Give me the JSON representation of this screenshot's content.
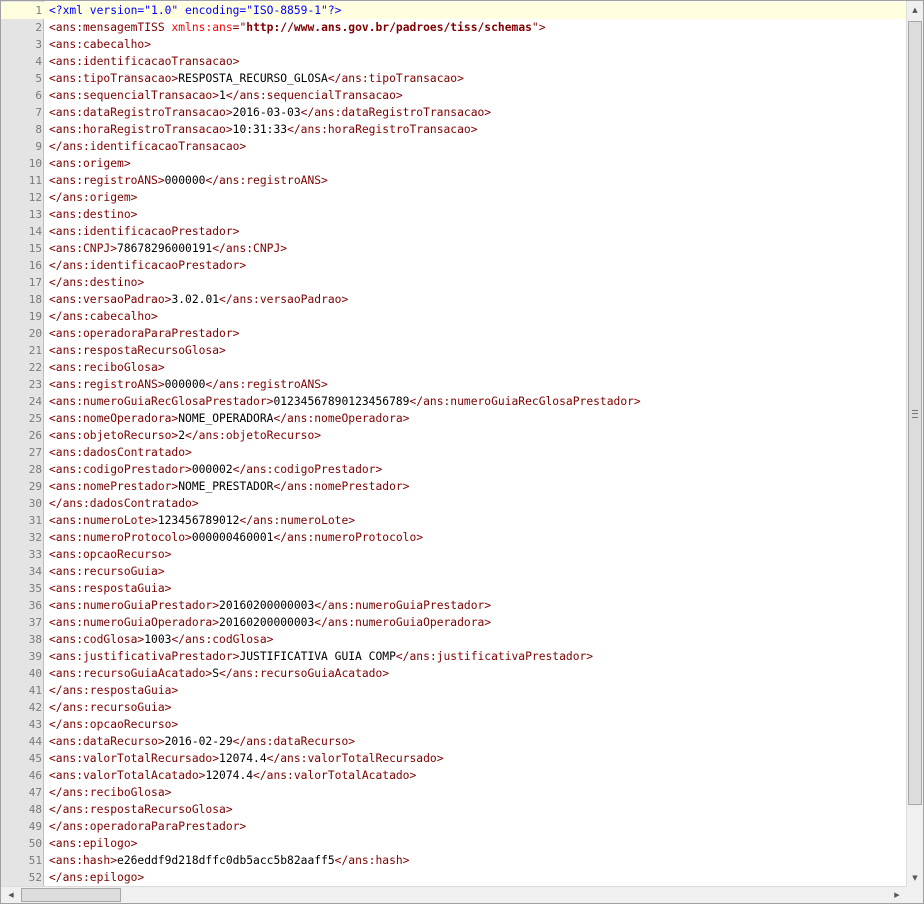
{
  "editor": {
    "current_line": 1,
    "lines": [
      [
        [
          "pi",
          "<?xml version=\"1.0\" encoding=\"ISO-8859-1\"?>"
        ]
      ],
      [
        [
          "tag",
          "<ans:mensagemTISS "
        ],
        [
          "attr",
          "xmlns:ans"
        ],
        [
          "tag",
          "=\""
        ],
        [
          "val",
          "http://www.ans.gov.br/padroes/tiss/schemas"
        ],
        [
          "tag",
          "\">"
        ]
      ],
      [
        [
          "tag",
          "<ans:cabecalho>"
        ]
      ],
      [
        [
          "tag",
          "<ans:identificacaoTransacao>"
        ]
      ],
      [
        [
          "tag",
          "<ans:tipoTransacao>"
        ],
        [
          "txt",
          "RESPOSTA_RECURSO_GLOSA"
        ],
        [
          "tag",
          "</ans:tipoTransacao>"
        ]
      ],
      [
        [
          "tag",
          "<ans:sequencialTransacao>"
        ],
        [
          "txt",
          "1"
        ],
        [
          "tag",
          "</ans:sequencialTransacao>"
        ]
      ],
      [
        [
          "tag",
          "<ans:dataRegistroTransacao>"
        ],
        [
          "txt",
          "2016-03-03"
        ],
        [
          "tag",
          "</ans:dataRegistroTransacao>"
        ]
      ],
      [
        [
          "tag",
          "<ans:horaRegistroTransacao>"
        ],
        [
          "txt",
          "10:31:33"
        ],
        [
          "tag",
          "</ans:horaRegistroTransacao>"
        ]
      ],
      [
        [
          "tag",
          "</ans:identificacaoTransacao>"
        ]
      ],
      [
        [
          "tag",
          "<ans:origem>"
        ]
      ],
      [
        [
          "tag",
          "<ans:registroANS>"
        ],
        [
          "txt",
          "000000"
        ],
        [
          "tag",
          "</ans:registroANS>"
        ]
      ],
      [
        [
          "tag",
          "</ans:origem>"
        ]
      ],
      [
        [
          "tag",
          "<ans:destino>"
        ]
      ],
      [
        [
          "tag",
          "<ans:identificacaoPrestador>"
        ]
      ],
      [
        [
          "tag",
          "<ans:CNPJ>"
        ],
        [
          "txt",
          "78678296000191"
        ],
        [
          "tag",
          "</ans:CNPJ>"
        ]
      ],
      [
        [
          "tag",
          "</ans:identificacaoPrestador>"
        ]
      ],
      [
        [
          "tag",
          "</ans:destino>"
        ]
      ],
      [
        [
          "tag",
          "<ans:versaoPadrao>"
        ],
        [
          "txt",
          "3.02.01"
        ],
        [
          "tag",
          "</ans:versaoPadrao>"
        ]
      ],
      [
        [
          "tag",
          "</ans:cabecalho>"
        ]
      ],
      [
        [
          "tag",
          "<ans:operadoraParaPrestador>"
        ]
      ],
      [
        [
          "tag",
          "<ans:respostaRecursoGlosa>"
        ]
      ],
      [
        [
          "tag",
          "<ans:reciboGlosa>"
        ]
      ],
      [
        [
          "tag",
          "<ans:registroANS>"
        ],
        [
          "txt",
          "000000"
        ],
        [
          "tag",
          "</ans:registroANS>"
        ]
      ],
      [
        [
          "tag",
          "<ans:numeroGuiaRecGlosaPrestador>"
        ],
        [
          "txt",
          "01234567890123456789"
        ],
        [
          "tag",
          "</ans:numeroGuiaRecGlosaPrestador>"
        ]
      ],
      [
        [
          "tag",
          "<ans:nomeOperadora>"
        ],
        [
          "txt",
          "NOME_OPERADORA"
        ],
        [
          "tag",
          "</ans:nomeOperadora>"
        ]
      ],
      [
        [
          "tag",
          "<ans:objetoRecurso>"
        ],
        [
          "txt",
          "2"
        ],
        [
          "tag",
          "</ans:objetoRecurso>"
        ]
      ],
      [
        [
          "tag",
          "<ans:dadosContratado>"
        ]
      ],
      [
        [
          "tag",
          "<ans:codigoPrestador>"
        ],
        [
          "txt",
          "000002"
        ],
        [
          "tag",
          "</ans:codigoPrestador>"
        ]
      ],
      [
        [
          "tag",
          "<ans:nomePrestador>"
        ],
        [
          "txt",
          "NOME_PRESTADOR"
        ],
        [
          "tag",
          "</ans:nomePrestador>"
        ]
      ],
      [
        [
          "tag",
          "</ans:dadosContratado>"
        ]
      ],
      [
        [
          "tag",
          "<ans:numeroLote>"
        ],
        [
          "txt",
          "123456789012"
        ],
        [
          "tag",
          "</ans:numeroLote>"
        ]
      ],
      [
        [
          "tag",
          "<ans:numeroProtocolo>"
        ],
        [
          "txt",
          "000000460001"
        ],
        [
          "tag",
          "</ans:numeroProtocolo>"
        ]
      ],
      [
        [
          "tag",
          "<ans:opcaoRecurso>"
        ]
      ],
      [
        [
          "tag",
          "<ans:recursoGuia>"
        ]
      ],
      [
        [
          "tag",
          "<ans:respostaGuia>"
        ]
      ],
      [
        [
          "tag",
          "<ans:numeroGuiaPrestador>"
        ],
        [
          "txt",
          "20160200000003"
        ],
        [
          "tag",
          "</ans:numeroGuiaPrestador>"
        ]
      ],
      [
        [
          "tag",
          "<ans:numeroGuiaOperadora>"
        ],
        [
          "txt",
          "20160200000003"
        ],
        [
          "tag",
          "</ans:numeroGuiaOperadora>"
        ]
      ],
      [
        [
          "tag",
          "<ans:codGlosa>"
        ],
        [
          "txt",
          "1003"
        ],
        [
          "tag",
          "</ans:codGlosa>"
        ]
      ],
      [
        [
          "tag",
          "<ans:justificativaPrestador>"
        ],
        [
          "txt",
          "JUSTIFICATIVA GUIA COMP"
        ],
        [
          "tag",
          "</ans:justificativaPrestador>"
        ]
      ],
      [
        [
          "tag",
          "<ans:recursoGuiaAcatado>"
        ],
        [
          "txt",
          "S"
        ],
        [
          "tag",
          "</ans:recursoGuiaAcatado>"
        ]
      ],
      [
        [
          "tag",
          "</ans:respostaGuia>"
        ]
      ],
      [
        [
          "tag",
          "</ans:recursoGuia>"
        ]
      ],
      [
        [
          "tag",
          "</ans:opcaoRecurso>"
        ]
      ],
      [
        [
          "tag",
          "<ans:dataRecurso>"
        ],
        [
          "txt",
          "2016-02-29"
        ],
        [
          "tag",
          "</ans:dataRecurso>"
        ]
      ],
      [
        [
          "tag",
          "<ans:valorTotalRecursado>"
        ],
        [
          "txt",
          "12074.4"
        ],
        [
          "tag",
          "</ans:valorTotalRecursado>"
        ]
      ],
      [
        [
          "tag",
          "<ans:valorTotalAcatado>"
        ],
        [
          "txt",
          "12074.4"
        ],
        [
          "tag",
          "</ans:valorTotalAcatado>"
        ]
      ],
      [
        [
          "tag",
          "</ans:reciboGlosa>"
        ]
      ],
      [
        [
          "tag",
          "</ans:respostaRecursoGlosa>"
        ]
      ],
      [
        [
          "tag",
          "</ans:operadoraParaPrestador>"
        ]
      ],
      [
        [
          "tag",
          "<ans:epilogo>"
        ]
      ],
      [
        [
          "tag",
          "<ans:hash>"
        ],
        [
          "txt",
          "e26eddf9d218dffc0db5acc5b82aaff5"
        ],
        [
          "tag",
          "</ans:hash>"
        ]
      ],
      [
        [
          "tag",
          "</ans:epilogo>"
        ]
      ]
    ]
  },
  "icons": {
    "scroll_up": "▲",
    "scroll_down": "▼",
    "scroll_left": "◀",
    "scroll_right": "▶"
  },
  "colors": {
    "tag": "#800000",
    "text": "#000000",
    "processing_instruction": "#0000ff",
    "attribute": "#ff0000",
    "line_highlight": "#ffffe0",
    "gutter": "#e4e4e4"
  }
}
